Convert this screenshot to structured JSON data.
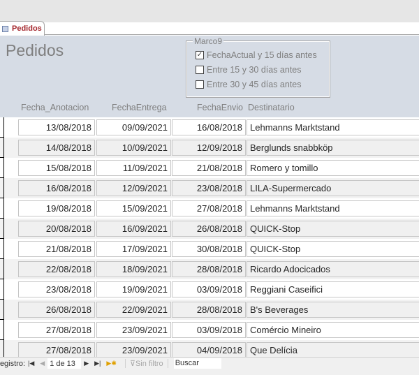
{
  "tab": {
    "label": "Pedidos",
    "icon": "form-icon"
  },
  "form": {
    "title": "Pedidos"
  },
  "frame": {
    "label": "Marco9",
    "options": [
      {
        "label": "FechaActual y 15 días antes",
        "checked": true
      },
      {
        "label": "Entre 15 y 30 días antes",
        "checked": false
      },
      {
        "label": "Entre 30 y 45 días antes",
        "checked": false
      }
    ]
  },
  "columns": [
    "Fecha_Anotacion",
    "FechaEntrega",
    "FechaEnvio",
    "Destinatario"
  ],
  "rows": [
    [
      "13/08/2018",
      "09/09/2021",
      "16/08/2018",
      "Lehmanns Marktstand"
    ],
    [
      "14/08/2018",
      "10/09/2021",
      "12/09/2018",
      "Berglunds snabbköp"
    ],
    [
      "15/08/2018",
      "11/09/2021",
      "21/08/2018",
      "Romero y tomillo"
    ],
    [
      "16/08/2018",
      "12/09/2021",
      "23/08/2018",
      "LILA-Supermercado"
    ],
    [
      "19/08/2018",
      "15/09/2021",
      "27/08/2018",
      "Lehmanns Marktstand"
    ],
    [
      "20/08/2018",
      "16/09/2021",
      "26/08/2018",
      "QUICK-Stop"
    ],
    [
      "21/08/2018",
      "17/09/2021",
      "30/08/2018",
      "QUICK-Stop"
    ],
    [
      "22/08/2018",
      "18/09/2021",
      "28/08/2018",
      "Ricardo Adocicados"
    ],
    [
      "23/08/2018",
      "19/09/2021",
      "03/09/2018",
      "Reggiani Caseifici"
    ],
    [
      "26/08/2018",
      "22/09/2021",
      "28/08/2018",
      "B's Beverages"
    ],
    [
      "27/08/2018",
      "23/09/2021",
      "03/09/2018",
      "Comércio Mineiro"
    ],
    [
      "27/08/2018",
      "23/09/2021",
      "04/09/2018",
      "Que Delícia"
    ]
  ],
  "nav": {
    "label": "Registro:",
    "position": "1 de 13",
    "filter": "Sin filtro",
    "search": "Buscar"
  }
}
